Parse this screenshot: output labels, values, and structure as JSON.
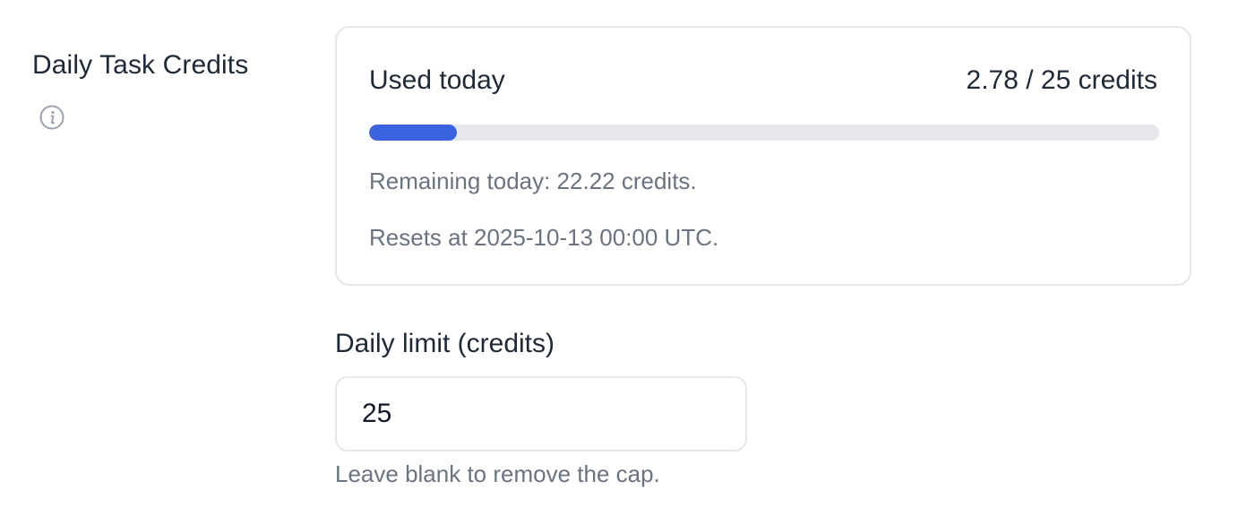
{
  "section": {
    "label": "Daily Task Credits",
    "info_icon": "info-icon"
  },
  "usage": {
    "title": "Used today",
    "value_text": "2.78 / 25 credits",
    "used": 2.78,
    "limit": 25,
    "progress_fraction": 0.1112,
    "remaining_text": "Remaining today: 22.22 credits.",
    "reset_text": "Resets at 2025-10-13 00:00 UTC."
  },
  "limit_field": {
    "label": "Daily limit (credits)",
    "value": "25",
    "helper": "Leave blank to remove the cap."
  },
  "colors": {
    "accent": "#3b63e0",
    "track": "#e5e7eb",
    "text_primary": "#1f2937",
    "text_muted": "#6b7280",
    "border": "#e5e7eb"
  }
}
